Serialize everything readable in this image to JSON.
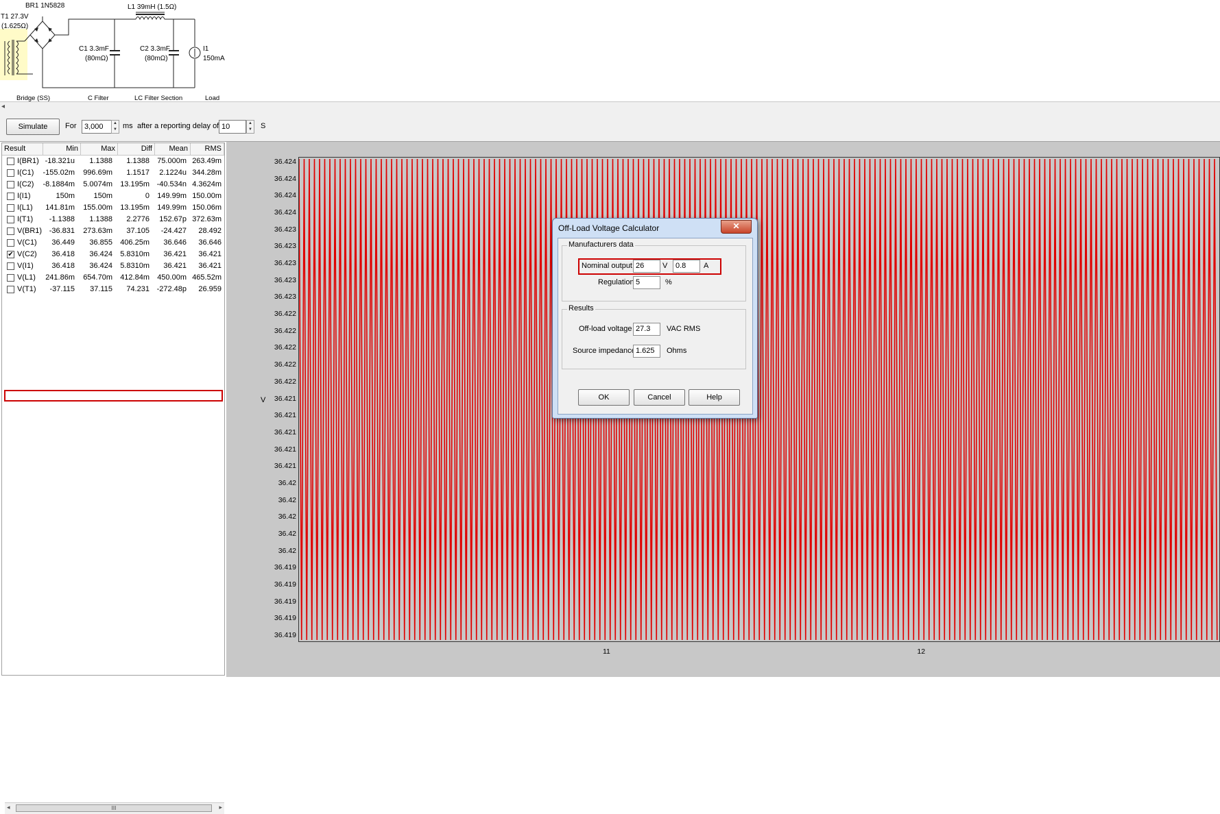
{
  "schematic": {
    "components": {
      "br1": "BR1 1N5828",
      "l1": "L1 39mH (1.5Ω)",
      "t1_line1": "T1 27.3V",
      "t1_line2": "(1.625Ω)",
      "c1_line1": "C1 3.3mF",
      "c1_line2": "(80mΩ)",
      "c2_line1": "C2 3.3mF",
      "c2_line2": "(80mΩ)",
      "i1_line1": "I1",
      "i1_line2": "150mA"
    },
    "sections": [
      "Bridge (SS)",
      "C Filter",
      "LC Filter Section",
      "Load"
    ]
  },
  "toolbar": {
    "simulate_label": "Simulate",
    "for_label": "For",
    "duration_value": "3,000",
    "ms_label": "ms",
    "delay_label": "after a reporting delay of",
    "delay_value": "10",
    "s_label": "S"
  },
  "results": {
    "columns": [
      "Result",
      "Min",
      "Max",
      "Diff",
      "Mean",
      "RMS"
    ],
    "rows": [
      {
        "name": "I(BR1)",
        "min": "-18.321u",
        "max": "1.1388",
        "diff": "1.1388",
        "mean": "75.000m",
        "rms": "263.49m",
        "checked": false
      },
      {
        "name": "I(C1)",
        "min": "-155.02m",
        "max": "996.69m",
        "diff": "1.1517",
        "mean": "2.1224u",
        "rms": "344.28m",
        "checked": false
      },
      {
        "name": "I(C2)",
        "min": "-8.1884m",
        "max": "5.0074m",
        "diff": "13.195m",
        "mean": "-40.534n",
        "rms": "4.3624m",
        "checked": false
      },
      {
        "name": "I(I1)",
        "min": "150m",
        "max": "150m",
        "diff": "0",
        "mean": "149.99m",
        "rms": "150.00m",
        "checked": false
      },
      {
        "name": "I(L1)",
        "min": "141.81m",
        "max": "155.00m",
        "diff": "13.195m",
        "mean": "149.99m",
        "rms": "150.06m",
        "checked": false
      },
      {
        "name": "I(T1)",
        "min": "-1.1388",
        "max": "1.1388",
        "diff": "2.2776",
        "mean": "152.67p",
        "rms": "372.63m",
        "checked": false
      },
      {
        "name": "V(BR1)",
        "min": "-36.831",
        "max": "273.63m",
        "diff": "37.105",
        "mean": "-24.427",
        "rms": "28.492",
        "checked": false
      },
      {
        "name": "V(C1)",
        "min": "36.449",
        "max": "36.855",
        "diff": "406.25m",
        "mean": "36.646",
        "rms": "36.646",
        "checked": false
      },
      {
        "name": "V(C2)",
        "min": "36.418",
        "max": "36.424",
        "diff": "5.8310m",
        "mean": "36.421",
        "rms": "36.421",
        "checked": true
      },
      {
        "name": "V(I1)",
        "min": "36.418",
        "max": "36.424",
        "diff": "5.8310m",
        "mean": "36.421",
        "rms": "36.421",
        "checked": false
      },
      {
        "name": "V(L1)",
        "min": "241.86m",
        "max": "654.70m",
        "diff": "412.84m",
        "mean": "450.00m",
        "rms": "465.52m",
        "checked": false
      },
      {
        "name": "V(T1)",
        "min": "-37.115",
        "max": "37.115",
        "diff": "74.231",
        "mean": "-272.48p",
        "rms": "26.959",
        "checked": false
      }
    ],
    "scroll_thumb": "III"
  },
  "chart_data": {
    "type": "line",
    "series": [
      {
        "values_min": 36.4185,
        "values_max": 36.4243,
        "color": "#e00000"
      }
    ],
    "ylabel": "V",
    "yticks": [
      "36.424",
      "36.424",
      "36.424",
      "36.424",
      "36.423",
      "36.423",
      "36.423",
      "36.423",
      "36.423",
      "36.422",
      "36.422",
      "36.422",
      "36.422",
      "36.422",
      "36.421",
      "36.421",
      "36.421",
      "36.421",
      "36.421",
      "36.42",
      "36.42",
      "36.42",
      "36.42",
      "36.42",
      "36.419",
      "36.419",
      "36.419",
      "36.419",
      "36.419"
    ],
    "xticks": [
      "11",
      "12"
    ],
    "xlim": [
      10.0205,
      12.9525
    ],
    "ylim": [
      36.4185,
      36.4243
    ],
    "line_color": "#e00000",
    "background": "#c8c8c8"
  },
  "dialog": {
    "title": "Off-Load Voltage Calculator",
    "close_label": "✕",
    "manufacturers_group": "Manufacturers data",
    "nominal_label": "Nominal output",
    "nominal_value": "26",
    "nominal_unit": "V",
    "current_value": "0.8",
    "current_unit": "A",
    "regulation_label": "Regulation",
    "regulation_value": "5",
    "regulation_unit": "%",
    "results_group": "Results",
    "offload_label": "Off-load voltage",
    "offload_value": "27.3",
    "offload_unit": "VAC RMS",
    "impedance_label": "Source impedance",
    "impedance_value": "1.625",
    "impedance_unit": "Ohms",
    "ok_label": "OK",
    "cancel_label": "Cancel",
    "help_label": "Help"
  }
}
